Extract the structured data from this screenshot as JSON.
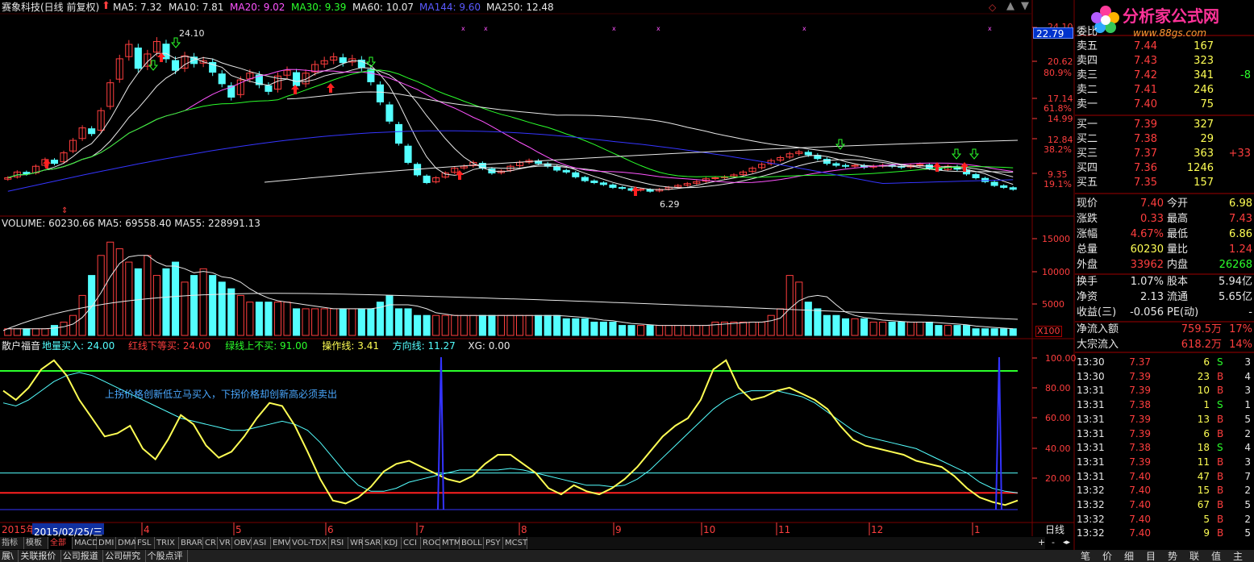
{
  "header": {
    "stock": "赛象科技(日线 前复权)",
    "ma": [
      {
        "label": "MA5: 7.32",
        "color": "#e8e8e8"
      },
      {
        "label": "MA10: 7.81",
        "color": "#e8e8e8"
      },
      {
        "label": "MA20: 9.02",
        "color": "#ff54ff"
      },
      {
        "label": "MA30: 9.39",
        "color": "#2bff2b"
      },
      {
        "label": "MA60: 10.07",
        "color": "#e8e8e8"
      },
      {
        "label": "MA144: 9.60",
        "color": "#5a5aff"
      },
      {
        "label": "MA250: 12.48",
        "color": "#e8e8e8"
      }
    ]
  },
  "logo": {
    "brand": "分析家公式网",
    "url_text": "www.88gs.com"
  },
  "price_axis": {
    "labels": [
      "24.10",
      "20.62",
      "80.9%",
      "17.14",
      "61.8%",
      "14.99",
      "12.84",
      "38.2%",
      "9.35",
      "19.1%"
    ],
    "current": "22.79"
  },
  "price_annotations": {
    "high": "24.10",
    "low": "6.29"
  },
  "volume_panel": {
    "title": "VOLUME: 60230.66  MA5: 69558.40  MA55: 228991.13",
    "axis": [
      "15000",
      "10000",
      "5000"
    ],
    "unit": "X100"
  },
  "indicator_panel": {
    "name": "散户福音",
    "params": [
      {
        "label": "地量买入: 24.00",
        "color": "#54ffff"
      },
      {
        "label": "红线下等买: 24.00",
        "color": "#ff3e3e"
      },
      {
        "label": "绿线上不买: 91.00",
        "color": "#2bff2b"
      },
      {
        "label": "操作线: 3.41",
        "color": "#ffff54"
      },
      {
        "label": "方向线: 11.27",
        "color": "#54ffff"
      },
      {
        "label": "XG: 0.00",
        "color": "#e8e8e8"
      }
    ],
    "annotation": "上拐价格创新低立马买入，下拐价格却创新高必须卖出",
    "axis": [
      "100.00",
      "80.00",
      "60.00",
      "40.00",
      "20.00"
    ]
  },
  "time_axis": {
    "year": "2015年",
    "date": "2015/02/25/三",
    "months": [
      "4",
      "5",
      "6",
      "7",
      "8",
      "9",
      "10",
      "11",
      "12",
      "1"
    ],
    "period": "日线"
  },
  "tabs": [
    "指标",
    "模板",
    "全部",
    "MACD",
    "DMI",
    "DMA",
    "FSL",
    "TRIX",
    "BRAR",
    "CR",
    "VR",
    "OBV",
    "ASI",
    "EMV",
    "VOL-TDX",
    "RSI",
    "WR",
    "SAR",
    "KDJ",
    "CCI",
    "ROC",
    "MTM",
    "BOLL",
    "PSY",
    "MCST"
  ],
  "bottom_tabs": [
    "展\\",
    "关联报价",
    "公司报道",
    "公司研究",
    "个股点评"
  ],
  "right_tabs": [
    "笔",
    "价",
    "细",
    "目",
    "势",
    "联",
    "值",
    "主"
  ],
  "quote": {
    "committee": {
      "label": "委比",
      "value": ""
    },
    "sell": [
      {
        "label": "卖五",
        "price": "7.44",
        "vol": "167",
        "chg": ""
      },
      {
        "label": "卖四",
        "price": "7.43",
        "vol": "323",
        "chg": ""
      },
      {
        "label": "卖三",
        "price": "7.42",
        "vol": "341",
        "chg": "-8"
      },
      {
        "label": "卖二",
        "price": "7.41",
        "vol": "246",
        "chg": ""
      },
      {
        "label": "卖一",
        "price": "7.40",
        "vol": "75",
        "chg": ""
      }
    ],
    "buy": [
      {
        "label": "买一",
        "price": "7.39",
        "vol": "327",
        "chg": ""
      },
      {
        "label": "买二",
        "price": "7.38",
        "vol": "29",
        "chg": ""
      },
      {
        "label": "买三",
        "price": "7.37",
        "vol": "363",
        "chg": "+33"
      },
      {
        "label": "买四",
        "price": "7.36",
        "vol": "1246",
        "chg": ""
      },
      {
        "label": "买五",
        "price": "7.35",
        "vol": "157",
        "chg": ""
      }
    ],
    "stats": [
      {
        "l1": "现价",
        "v1": "7.40",
        "c1": "#ff3e3e",
        "l2": "今开",
        "v2": "6.98",
        "c2": "#ffff54"
      },
      {
        "l1": "涨跌",
        "v1": "0.33",
        "c1": "#ff3e3e",
        "l2": "最高",
        "v2": "7.43",
        "c2": "#ff3e3e"
      },
      {
        "l1": "涨幅",
        "v1": "4.67%",
        "c1": "#ff3e3e",
        "l2": "最低",
        "v2": "6.86",
        "c2": "#ffff54"
      },
      {
        "l1": "总量",
        "v1": "60230",
        "c1": "#ffff54",
        "l2": "量比",
        "v2": "1.24",
        "c2": "#ff3e3e"
      },
      {
        "l1": "外盘",
        "v1": "33962",
        "c1": "#ff3e3e",
        "l2": "内盘",
        "v2": "26268",
        "c2": "#2bff2b"
      }
    ],
    "fin": [
      {
        "l1": "换手",
        "v1": "1.07%",
        "l2": "股本",
        "v2": "5.94亿"
      },
      {
        "l1": "净资",
        "v1": "2.13",
        "l2": "流通",
        "v2": "5.65亿"
      },
      {
        "l1": "收益(三)",
        "v1": "-0.056",
        "l2": "PE(动)",
        "v2": "-"
      }
    ],
    "flow": [
      {
        "label": "净流入额",
        "value": "759.5万",
        "pct": "17%"
      },
      {
        "label": "大宗流入",
        "value": "618.2万",
        "pct": "14%"
      }
    ],
    "ticks": [
      {
        "time": "13:30",
        "price": "7.37",
        "vol": "6",
        "bs": "S",
        "n": "3"
      },
      {
        "time": "13:30",
        "price": "7.39",
        "vol": "23",
        "bs": "B",
        "n": "4"
      },
      {
        "time": "13:31",
        "price": "7.39",
        "vol": "10",
        "bs": "B",
        "n": "3"
      },
      {
        "time": "13:31",
        "price": "7.38",
        "vol": "1",
        "bs": "S",
        "n": "1"
      },
      {
        "time": "13:31",
        "price": "7.39",
        "vol": "13",
        "bs": "B",
        "n": "5"
      },
      {
        "time": "13:31",
        "price": "7.39",
        "vol": "6",
        "bs": "B",
        "n": "2"
      },
      {
        "time": "13:31",
        "price": "7.38",
        "vol": "18",
        "bs": "S",
        "n": "4"
      },
      {
        "time": "13:31",
        "price": "7.39",
        "vol": "11",
        "bs": "B",
        "n": "3"
      },
      {
        "time": "13:31",
        "price": "7.40",
        "vol": "47",
        "bs": "B",
        "n": "7"
      },
      {
        "time": "13:32",
        "price": "7.40",
        "vol": "15",
        "bs": "B",
        "n": "2"
      },
      {
        "time": "13:32",
        "price": "7.40",
        "vol": "67",
        "bs": "B",
        "n": "5"
      },
      {
        "time": "13:32",
        "price": "7.40",
        "vol": "5",
        "bs": "B",
        "n": "2"
      },
      {
        "time": "13:32",
        "price": "7.40",
        "vol": "9",
        "bs": "B",
        "n": "5"
      }
    ]
  },
  "colors": {
    "up": "#ff3e3e",
    "down": "#54ffff",
    "grid": "#7a0000",
    "bg": "#000000"
  },
  "chart_data": {
    "type": "candlestick",
    "price_range": [
      6.29,
      24.1
    ],
    "volume_range": [
      0,
      15000
    ],
    "indicator_range": [
      0,
      100
    ],
    "closes": [
      8.6,
      9.2,
      9.0,
      9.8,
      10.5,
      10.1,
      11.2,
      12.5,
      13.8,
      13.2,
      15.6,
      18.5,
      21.0,
      22.5,
      20.0,
      21.5,
      22.8,
      21.0,
      19.8,
      21.3,
      20.5,
      20.8,
      19.6,
      18.4,
      17.0,
      18.8,
      19.5,
      18.3,
      17.6,
      19.2,
      19.8,
      18.2,
      19.5,
      20.4,
      20.8,
      21.2,
      20.6,
      21.0,
      20.1,
      18.6,
      16.5,
      14.5,
      12.2,
      10.2,
      8.9,
      8.1,
      8.6,
      9.1,
      9.6,
      9.8,
      10.2,
      9.6,
      9.1,
      9.3,
      9.8,
      10.2,
      10.4,
      10.1,
      9.8,
      9.4,
      9.2,
      8.7,
      8.3,
      8.1,
      7.9,
      7.6,
      7.5,
      7.3,
      7.4,
      7.2,
      7.4,
      7.6,
      7.8,
      8.0,
      8.2,
      8.5,
      8.6,
      8.7,
      8.9,
      9.2,
      9.6,
      10.0,
      10.4,
      10.7,
      11.1,
      11.3,
      11.0,
      10.6,
      10.1,
      9.9,
      9.8,
      9.9,
      9.7,
      9.8,
      9.9,
      9.8,
      9.7,
      9.9,
      10.0,
      9.6,
      9.4,
      9.8,
      9.5,
      9.0,
      8.6,
      8.2,
      7.8,
      7.6,
      7.4
    ],
    "volumes": [
      1,
      1,
      1,
      1,
      1,
      1.5,
      2,
      3,
      6,
      9,
      12,
      14,
      13,
      11,
      10,
      12,
      9,
      10,
      11,
      8,
      9,
      10,
      9,
      8,
      7,
      6,
      5,
      5,
      5,
      5,
      5,
      4,
      4,
      4,
      4,
      4,
      4,
      4,
      4,
      4,
      5,
      6,
      4,
      4,
      3,
      3,
      3,
      3,
      3,
      3,
      3,
      3,
      3,
      3,
      3,
      3,
      3,
      3,
      3,
      3,
      2.5,
      2.5,
      2.5,
      2,
      2,
      2,
      1.5,
      1.5,
      1.5,
      1.5,
      1.5,
      1.5,
      1.5,
      1.5,
      1.5,
      1.5,
      2,
      2,
      2,
      2,
      2,
      2,
      3,
      4,
      9,
      8,
      5,
      4,
      3,
      3,
      2.5,
      2.5,
      2.5,
      2,
      2,
      2,
      2,
      2,
      2,
      2,
      1.5,
      1.5,
      1.5,
      1.5,
      1,
      1,
      1,
      1,
      1
    ],
    "operation_line": [
      78,
      72,
      80,
      92,
      98,
      88,
      72,
      60,
      48,
      50,
      55,
      40,
      33,
      46,
      62,
      56,
      42,
      34,
      38,
      48,
      60,
      70,
      68,
      55,
      38,
      20,
      6,
      4,
      8,
      15,
      25,
      30,
      32,
      28,
      24,
      20,
      18,
      22,
      30,
      36,
      36,
      30,
      24,
      14,
      10,
      16,
      12,
      10,
      14,
      20,
      28,
      38,
      48,
      55,
      60,
      72,
      92,
      98,
      80,
      72,
      74,
      78,
      80,
      76,
      72,
      66,
      55,
      46,
      42,
      40,
      38,
      36,
      32,
      30,
      28,
      22,
      14,
      8,
      5,
      3,
      6
    ],
    "direction_line": [
      70,
      68,
      72,
      78,
      84,
      88,
      90,
      88,
      84,
      80,
      76,
      72,
      68,
      64,
      60,
      58,
      56,
      54,
      52,
      52,
      54,
      56,
      58,
      56,
      52,
      44,
      34,
      24,
      16,
      12,
      12,
      14,
      18,
      20,
      22,
      24,
      26,
      26,
      26,
      26,
      27,
      26,
      24,
      22,
      20,
      18,
      16,
      16,
      15,
      16,
      20,
      26,
      34,
      42,
      50,
      58,
      66,
      72,
      76,
      78,
      78,
      78,
      76,
      74,
      70,
      64,
      58,
      52,
      48,
      46,
      44,
      42,
      40,
      36,
      32,
      28,
      24,
      18,
      14,
      12,
      11
    ]
  }
}
